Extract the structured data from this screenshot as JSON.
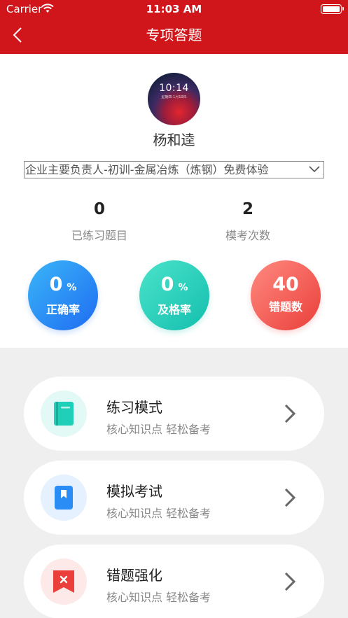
{
  "status_bar": {
    "carrier": "Carrier",
    "time": "11:03 AM",
    "wifi_icon": "wifi-icon",
    "battery_icon": "battery-icon"
  },
  "nav": {
    "title": "专项答题",
    "back_icon": "chevron-left-icon"
  },
  "profile": {
    "avatar_clock": "10:14",
    "avatar_sub": "星期四 1月10日",
    "name": "杨和逵",
    "course_selected": "企业主要负责人-初训-金属冶炼（炼钢）免费体验"
  },
  "stats": [
    {
      "value": "0",
      "label": "已练习题目"
    },
    {
      "value": "2",
      "label": "模考次数"
    }
  ],
  "rates": [
    {
      "value": "0",
      "unit": "%",
      "label": "正确率",
      "color": "#2a8cf5"
    },
    {
      "value": "0",
      "unit": "%",
      "label": "及格率",
      "color": "#1fcfb8"
    },
    {
      "value": "40",
      "unit": "",
      "label": "错题数",
      "color": "#f05a52"
    }
  ],
  "modes": [
    {
      "title": "练习模式",
      "subtitle": "核心知识点 轻松备考",
      "icon": "book-icon",
      "accent": "#1fcfb8"
    },
    {
      "title": "模拟考试",
      "subtitle": "核心知识点 轻松备考",
      "icon": "bookmark-icon",
      "accent": "#2a8cf5"
    },
    {
      "title": "错题强化",
      "subtitle": "核心知识点 轻松备考",
      "icon": "error-flag-icon",
      "accent": "#ea3f3a"
    }
  ]
}
